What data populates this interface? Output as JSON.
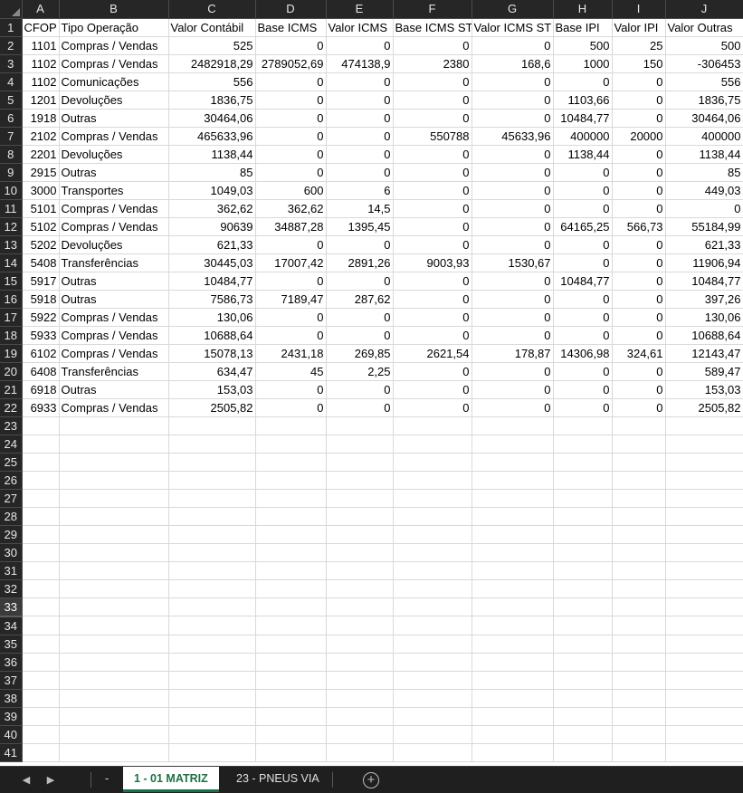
{
  "columns": [
    "A",
    "B",
    "C",
    "D",
    "E",
    "F",
    "G",
    "H",
    "I",
    "J"
  ],
  "rows": [
    [
      "CFOP",
      "Tipo Operação",
      "Valor Contábil",
      "Base ICMS",
      "Valor ICMS",
      "Base ICMS ST",
      "Valor ICMS ST",
      "Base IPI",
      "Valor IPI",
      "Valor Outras"
    ],
    [
      "1101",
      "Compras / Vendas",
      "525",
      "0",
      "0",
      "0",
      "0",
      "500",
      "25",
      "500"
    ],
    [
      "1102",
      "Compras / Vendas",
      "2482918,29",
      "2789052,69",
      "474138,9",
      "2380",
      "168,6",
      "1000",
      "150",
      "-306453"
    ],
    [
      "1102",
      "Comunicações",
      "556",
      "0",
      "0",
      "0",
      "0",
      "0",
      "0",
      "556"
    ],
    [
      "1201",
      "Devoluções",
      "1836,75",
      "0",
      "0",
      "0",
      "0",
      "1103,66",
      "0",
      "1836,75"
    ],
    [
      "1918",
      "Outras",
      "30464,06",
      "0",
      "0",
      "0",
      "0",
      "10484,77",
      "0",
      "30464,06"
    ],
    [
      "2102",
      "Compras / Vendas",
      "465633,96",
      "0",
      "0",
      "550788",
      "45633,96",
      "400000",
      "20000",
      "400000"
    ],
    [
      "2201",
      "Devoluções",
      "1138,44",
      "0",
      "0",
      "0",
      "0",
      "1138,44",
      "0",
      "1138,44"
    ],
    [
      "2915",
      "Outras",
      "85",
      "0",
      "0",
      "0",
      "0",
      "0",
      "0",
      "85"
    ],
    [
      "3000",
      "Transportes",
      "1049,03",
      "600",
      "6",
      "0",
      "0",
      "0",
      "0",
      "449,03"
    ],
    [
      "5101",
      "Compras / Vendas",
      "362,62",
      "362,62",
      "14,5",
      "0",
      "0",
      "0",
      "0",
      "0"
    ],
    [
      "5102",
      "Compras / Vendas",
      "90639",
      "34887,28",
      "1395,45",
      "0",
      "0",
      "64165,25",
      "566,73",
      "55184,99"
    ],
    [
      "5202",
      "Devoluções",
      "621,33",
      "0",
      "0",
      "0",
      "0",
      "0",
      "0",
      "621,33"
    ],
    [
      "5408",
      "Transferências",
      "30445,03",
      "17007,42",
      "2891,26",
      "9003,93",
      "1530,67",
      "0",
      "0",
      "11906,94"
    ],
    [
      "5917",
      "Outras",
      "10484,77",
      "0",
      "0",
      "0",
      "0",
      "10484,77",
      "0",
      "10484,77"
    ],
    [
      "5918",
      "Outras",
      "7586,73",
      "7189,47",
      "287,62",
      "0",
      "0",
      "0",
      "0",
      "397,26"
    ],
    [
      "5922",
      "Compras / Vendas",
      "130,06",
      "0",
      "0",
      "0",
      "0",
      "0",
      "0",
      "130,06"
    ],
    [
      "5933",
      "Compras / Vendas",
      "10688,64",
      "0",
      "0",
      "0",
      "0",
      "0",
      "0",
      "10688,64"
    ],
    [
      "6102",
      "Compras / Vendas",
      "15078,13",
      "2431,18",
      "269,85",
      "2621,54",
      "178,87",
      "14306,98",
      "324,61",
      "12143,47"
    ],
    [
      "6408",
      "Transferências",
      "634,47",
      "45",
      "2,25",
      "0",
      "0",
      "0",
      "0",
      "589,47"
    ],
    [
      "6918",
      "Outras",
      "153,03",
      "0",
      "0",
      "0",
      "0",
      "0",
      "0",
      "153,03"
    ],
    [
      "6933",
      "Compras / Vendas",
      "2505,82",
      "0",
      "0",
      "0",
      "0",
      "0",
      "0",
      "2505,82"
    ]
  ],
  "total_rows": 41,
  "active_row": 33,
  "tabs": {
    "prev_icon": "chevron-left-icon",
    "next_icon": "chevron-right-icon",
    "items": [
      {
        "label": "-",
        "active": false
      },
      {
        "label": "1 - 01 MATRIZ",
        "active": true
      },
      {
        "label": "23 - PNEUS VIA",
        "active": false
      }
    ],
    "add_icon": "plus-circle-icon",
    "accent_color": "#1e7145"
  }
}
